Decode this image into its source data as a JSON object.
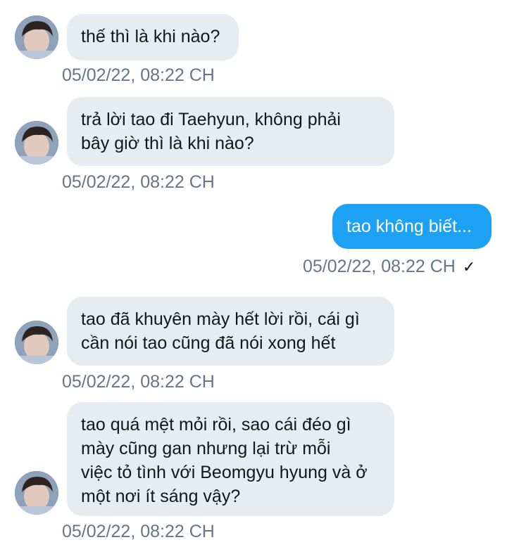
{
  "messages": [
    {
      "direction": "received",
      "lines": [
        "thế thì là khi nào?"
      ],
      "timestamp": "05/02/22, 08:22 CH"
    },
    {
      "direction": "received",
      "lines": [
        "trả lời tao đi Taehyun, không phải",
        "bây giờ thì là khi nào?"
      ],
      "timestamp": "05/02/22, 08:22 CH"
    },
    {
      "direction": "sent",
      "lines": [
        "tao không biết..."
      ],
      "timestamp": "05/02/22, 08:22 CH",
      "status_glyph": "✓"
    },
    {
      "direction": "received",
      "lines": [
        "tao đã khuyên mày hết lời rồi, cái gì",
        "cần nói tao cũng đã nói xong hết"
      ],
      "timestamp": "05/02/22, 08:22 CH"
    },
    {
      "direction": "received",
      "lines": [
        "tao quá mệt mỏi rồi, sao cái đéo gì",
        "mày cũng gan nhưng lại trừ mỗi",
        "việc tỏ tình với Beomgyu hyung và ở",
        "một nơi ít sáng vậy?"
      ],
      "timestamp": "05/02/22, 08:22 CH"
    }
  ],
  "colors": {
    "received_bubble": "#e6ecf0",
    "sent_bubble": "#1da1f2",
    "timestamp": "#657786"
  },
  "icons": {
    "avatar": "contact-avatar",
    "read_status": "checkmark-icon"
  }
}
